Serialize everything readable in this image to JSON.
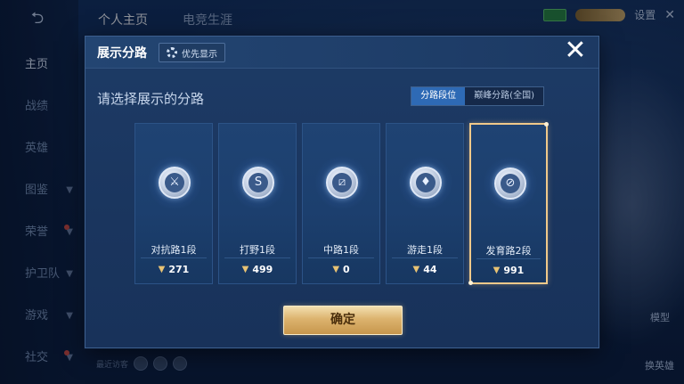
{
  "background": {
    "top_tabs": [
      "个人主页",
      "电竞生涯"
    ],
    "sidebar": [
      {
        "label": "主页",
        "active": true,
        "chevron": false,
        "dot": false
      },
      {
        "label": "战绩",
        "active": false,
        "chevron": false,
        "dot": false
      },
      {
        "label": "英雄",
        "active": false,
        "chevron": false,
        "dot": false
      },
      {
        "label": "图鉴",
        "active": false,
        "chevron": true,
        "dot": false
      },
      {
        "label": "荣誉",
        "active": false,
        "chevron": true,
        "dot": true
      },
      {
        "label": "护卫队",
        "active": false,
        "chevron": true,
        "dot": false
      },
      {
        "label": "游戏",
        "active": false,
        "chevron": true,
        "dot": false
      },
      {
        "label": "社交",
        "active": false,
        "chevron": true,
        "dot": true
      }
    ],
    "settings_label": "设置",
    "recent_visitors_label": "最近访客",
    "model_label": "模型",
    "change_hero_label": "换英雄"
  },
  "dialog": {
    "title": "展示分路",
    "priority_button": "优先显示",
    "subtitle": "请选择展示的分路",
    "segments": [
      {
        "label": "分路段位",
        "active": true
      },
      {
        "label": "巅峰分路(全国)",
        "active": false
      }
    ],
    "cards": [
      {
        "label": "对抗路1段",
        "score": "271",
        "icon": "sword-emblem-icon",
        "glyph": "⚔",
        "selected": false
      },
      {
        "label": "打野1段",
        "score": "499",
        "icon": "jungle-emblem-icon",
        "glyph": "S",
        "selected": false
      },
      {
        "label": "中路1段",
        "score": "0",
        "icon": "mid-emblem-icon",
        "glyph": "⧄",
        "selected": false
      },
      {
        "label": "游走1段",
        "score": "44",
        "icon": "roam-emblem-icon",
        "glyph": "♦",
        "selected": false
      },
      {
        "label": "发育路2段",
        "score": "991",
        "icon": "farm-emblem-icon",
        "glyph": "⊘",
        "selected": true
      }
    ],
    "confirm_button": "确定",
    "close_glyph": "✕"
  },
  "colors": {
    "accent_blue": "#2e6ab5",
    "selected_border": "#f0c98a",
    "confirm_gold": "#dcb36e"
  }
}
